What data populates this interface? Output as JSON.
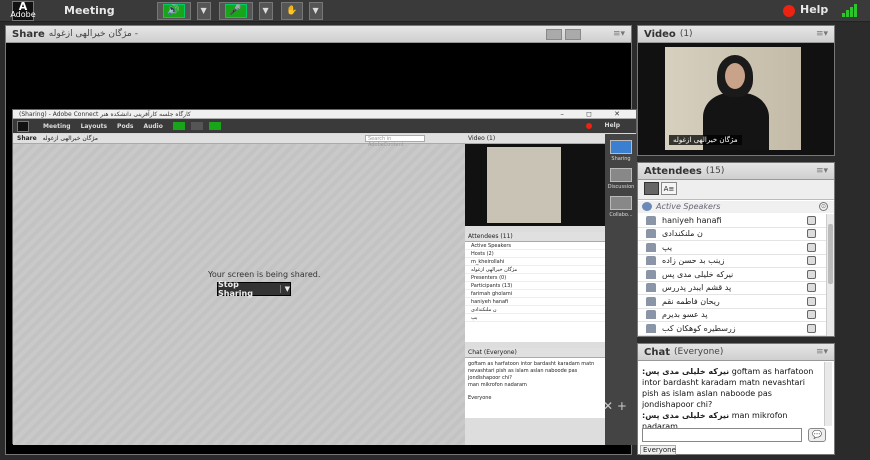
{
  "topbar": {
    "logo_text": "Adobe",
    "menu_meeting": "Meeting",
    "help": "Help",
    "colors": {
      "green": "#18a51a",
      "record": "#e21111"
    }
  },
  "share": {
    "title": "Share",
    "subtitle": "مژگان خیرالهی ازغوله -",
    "menu_icon": "menu-icon"
  },
  "inner_window": {
    "title": "(Sharing) - Adobe Connect کارگاه جلسه کارآفرینی دانشکده هنر",
    "menus": [
      "Meeting",
      "Layouts",
      "Pods",
      "Audio"
    ],
    "help": "Help",
    "share_title": "Share",
    "share_sub": "مژگان خیرالهی ازغوله",
    "search_placeholder": "Search in AdobeContent",
    "shared_text": "Your screen is being shared.",
    "stop_sharing": "Stop Sharing",
    "video_title": "Video (1)",
    "attendees_title": "Attendees (11)",
    "attendee_lines": [
      "Active Speakers",
      "Hosts (2)",
      "m_kheirollahi",
      "مژگان خیرالهی ازغوله",
      "Presenters (0)",
      "Participants (13)",
      "farimah gholami",
      "haniyeh hanafi",
      "ن ملنکندادی",
      "یپ"
    ],
    "chat_title": "Chat (Everyone)",
    "chat_lines": [
      "goftam as harfatoon intor bardasht karadam matn nevashtari pish as islam aslan naboode pas jondishapoor chi?",
      "man mikrofon nadaram"
    ],
    "chat_tabs": [
      "Everyone"
    ],
    "side_tiles": [
      "Sharing",
      "Discussion",
      "Collabo..."
    ]
  },
  "video": {
    "title": "Video",
    "count": "(1)",
    "name_tag": "مژگان خیرالهی ازغوله"
  },
  "attendees": {
    "title": "Attendees",
    "count": "(15)",
    "active_speakers": "Active Speakers",
    "list": [
      "haniyeh hanafi",
      "ن ملنکندادی",
      "یپ",
      "زینب بد حسن زاده",
      "نیرکه خلیلی مدی پس",
      "پد قشم ایبدر پدررس",
      "ریحان فاطمه نقم",
      "پد عسو بدیرم",
      "زرسطیره کوهکان کب"
    ]
  },
  "chat": {
    "title": "Chat",
    "scope": "(Everyone)",
    "messages": [
      {
        "who": ":نیرکه خلیلی مدی پس",
        "text": "goftam as harfatoon intor bardasht karadam matn nevashtari pish as islam aslan naboode pas jondishapoor chi?"
      },
      {
        "who": ":نیرکه خلیلی مدی پس",
        "text": "man mikrofon nadaram"
      }
    ],
    "tab": "Everyone"
  }
}
